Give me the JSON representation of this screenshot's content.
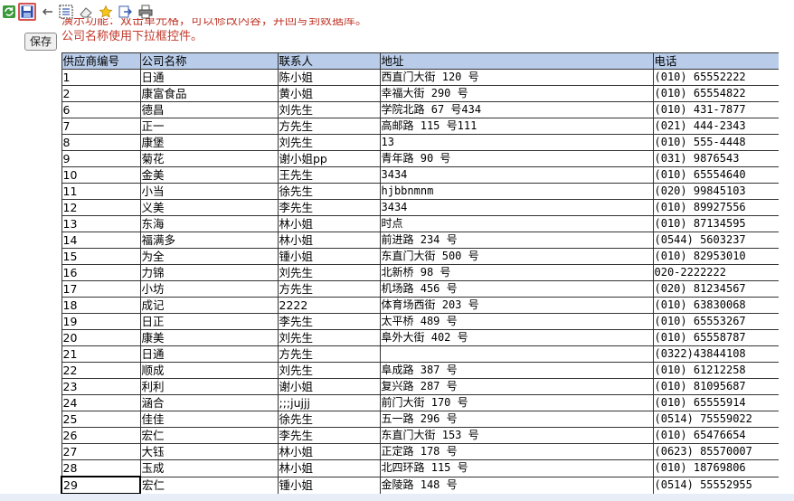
{
  "toolbar": {
    "buttons": [
      {
        "name": "refresh-icon",
        "active": false
      },
      {
        "name": "save-icon",
        "active": true
      },
      {
        "name": "undo-arrow-icon",
        "active": false
      },
      {
        "name": "grid-select-icon",
        "active": false
      },
      {
        "name": "eraser-icon",
        "active": false
      },
      {
        "name": "star-icon",
        "active": false
      },
      {
        "name": "export-icon",
        "active": false
      },
      {
        "name": "print-icon",
        "active": false
      }
    ],
    "tooltip": "保存"
  },
  "hints": {
    "line1": "演示功能：双击单元格，可以修改内容，并回写到数据库。",
    "line2": "公司名称使用下拉框控件。"
  },
  "table": {
    "columns": [
      "供应商编号",
      "公司名称",
      "联系人",
      "地址",
      "电话"
    ],
    "rows": [
      [
        "1",
        "日通",
        "陈小姐",
        "西直门大街 120 号",
        "(010) 65552222"
      ],
      [
        "2",
        "康富食品",
        "黄小姐",
        "幸福大街 290 号",
        "(010) 65554822"
      ],
      [
        "6",
        "德昌",
        "刘先生",
        "学院北路 67 号434",
        "(010) 431-7877"
      ],
      [
        "7",
        "正一",
        "方先生",
        "高邮路 115 号111",
        "(021) 444-2343"
      ],
      [
        "8",
        "康堡",
        "刘先生",
        "13",
        "(010) 555-4448"
      ],
      [
        "9",
        "菊花",
        "谢小姐pp",
        "青年路 90 号",
        "(031) 9876543"
      ],
      [
        "10",
        "金美",
        "王先生",
        "3434",
        "(010) 65554640"
      ],
      [
        "11",
        "小当",
        "徐先生",
        "hjbbnmnm",
        "(020) 99845103"
      ],
      [
        "12",
        "义美",
        "李先生",
        "3434",
        "(010) 89927556"
      ],
      [
        "13",
        "东海",
        "林小姐",
        "时点",
        "(010) 87134595"
      ],
      [
        "14",
        "福满多",
        "林小姐",
        "前进路 234 号",
        "(0544) 5603237"
      ],
      [
        "15",
        "为全",
        "锺小姐",
        "东直门大街 500 号",
        "(010) 82953010"
      ],
      [
        "16",
        "力锦",
        "刘先生",
        "北新桥 98 号",
        "020-2222222"
      ],
      [
        "17",
        "小坊",
        "方先生",
        "机场路 456 号",
        "(020) 81234567"
      ],
      [
        "18",
        "成记",
        "2222",
        "体育场西街 203 号",
        "(010) 63830068"
      ],
      [
        "19",
        "日正",
        "李先生",
        "太平桥 489 号",
        "(010) 65553267"
      ],
      [
        "20",
        "康美",
        "刘先生",
        "阜外大街 402 号",
        "(010) 65558787"
      ],
      [
        "21",
        "日通",
        "方先生",
        "",
        "(0322)43844108"
      ],
      [
        "22",
        "顺成",
        "刘先生",
        "阜成路 387 号",
        "(010) 61212258"
      ],
      [
        "23",
        "利利",
        "谢小姐",
        "复兴路 287 号",
        "(010) 81095687"
      ],
      [
        "24",
        "涵合",
        ";;;jujjj",
        "前门大街 170 号",
        "(010) 65555914"
      ],
      [
        "25",
        "佳佳",
        "徐先生",
        "五一路 296 号",
        "(0514) 75559022"
      ],
      [
        "26",
        "宏仁",
        "李先生",
        "东直门大街 153 号",
        "(010) 65476654"
      ],
      [
        "27",
        "大钰",
        "林小姐",
        "正定路 178 号",
        "(0623) 85570007"
      ],
      [
        "28",
        "玉成",
        "林小姐",
        "北四环路 115 号",
        "(010) 18769806"
      ],
      [
        "29",
        "宏仁",
        "锺小姐",
        "金陵路 148 号",
        "(0514) 55552955"
      ]
    ]
  }
}
